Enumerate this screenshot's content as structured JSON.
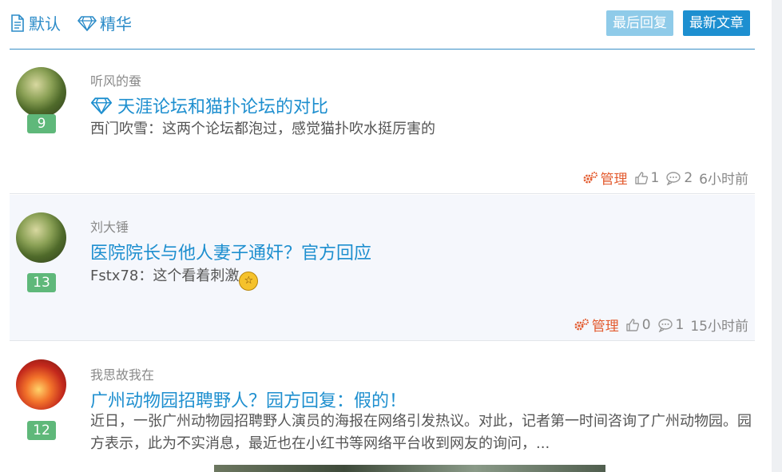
{
  "tabs": {
    "default_label": "默认",
    "featured_label": "精华"
  },
  "sort_buttons": {
    "last_reply": "最后回复",
    "newest": "最新文章"
  },
  "posts": [
    {
      "author": "听风的蚕",
      "title": "天涯论坛和猫扑论坛的对比",
      "featured": true,
      "reply_count": "9",
      "excerpt": "西门吹雪：这两个论坛都泡过，感觉猫扑吹水挺厉害的",
      "manage_label": "管理",
      "likes": "1",
      "comments": "2",
      "time": "6小时前"
    },
    {
      "author": "刘大锤",
      "title": "医院院长与他人妻子通奸？官方回应",
      "featured": false,
      "reply_count": "13",
      "excerpt": "Fstx78：这个看着刺激",
      "manage_label": "管理",
      "likes": "0",
      "comments": "1",
      "time": "15小时前"
    },
    {
      "author": "我思故我在",
      "title": "广州动物园招聘野人？园方回复：假的！",
      "featured": false,
      "reply_count": "12",
      "excerpt": "近日，一张广州动物园招聘野人演员的海报在网络引发热议。对此，记者第一时间咨询了广州动物园。园方表示，此为不实消息，最近也在小红书等网络平台收到网友的询问，..."
    }
  ],
  "colors": {
    "accent": "#1e8fcf",
    "badge": "#5fb87a",
    "manage": "#e35b2f"
  }
}
